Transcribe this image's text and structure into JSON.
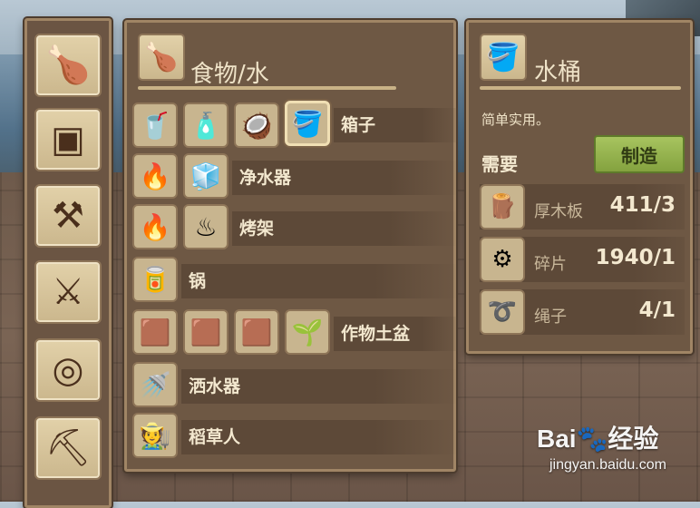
{
  "category_sidebar": {
    "buttons": [
      {
        "name": "food-water",
        "icon": "drumstick-drop-icon",
        "glyph": "🍗"
      },
      {
        "name": "storage",
        "icon": "crate-icon",
        "glyph": "▣"
      },
      {
        "name": "tools",
        "icon": "hammer-axe-icon",
        "glyph": "⚒"
      },
      {
        "name": "weapons",
        "icon": "crossed-swords-icon",
        "glyph": "⚔"
      },
      {
        "name": "equipment",
        "icon": "snorkel-mask-icon",
        "glyph": "◎"
      },
      {
        "name": "other",
        "icon": "drill-icon",
        "glyph": "⛏"
      }
    ]
  },
  "list_panel": {
    "title": "食物/水",
    "title_icon": "drumstick-icon",
    "rows": [
      {
        "label": "箱子",
        "items": [
          {
            "name": "cup",
            "glyph": "🥤"
          },
          {
            "name": "plastic-bottle",
            "glyph": "🧴"
          },
          {
            "name": "coconut-bowl",
            "glyph": "🥥"
          },
          {
            "name": "bucket",
            "glyph": "🪣",
            "selected": true
          }
        ]
      },
      {
        "label": "净水器",
        "items": [
          {
            "name": "simple-purifier",
            "glyph": "🔥"
          },
          {
            "name": "advanced-purifier",
            "glyph": "🧊"
          }
        ]
      },
      {
        "label": "烤架",
        "items": [
          {
            "name": "simple-grill",
            "glyph": "🔥"
          },
          {
            "name": "advanced-grill",
            "glyph": "♨"
          }
        ]
      },
      {
        "label": "锅",
        "items": [
          {
            "name": "cooking-pot",
            "glyph": "🥫"
          }
        ]
      },
      {
        "label": "作物土盆",
        "items": [
          {
            "name": "small-plot",
            "glyph": "🟫"
          },
          {
            "name": "medium-plot",
            "glyph": "🟫"
          },
          {
            "name": "large-plot",
            "glyph": "🟫"
          },
          {
            "name": "grass-plot",
            "glyph": "🌱"
          }
        ]
      },
      {
        "label": "洒水器",
        "items": [
          {
            "name": "sprinkler",
            "glyph": "🚿"
          }
        ]
      },
      {
        "label": "稻草人",
        "items": [
          {
            "name": "scarecrow",
            "glyph": "🧑‍🌾"
          }
        ]
      }
    ]
  },
  "detail_panel": {
    "title": "水桶",
    "title_icon": "bucket-icon",
    "description": "简单实用。",
    "requires_label": "需要",
    "craft_button": "制造",
    "requirements": [
      {
        "name": "厚木板",
        "count": "411/3",
        "icon": "plank-icon",
        "glyph": "🪵"
      },
      {
        "name": "碎片",
        "count": "1940/1",
        "icon": "scrap-icon",
        "glyph": "⚙"
      },
      {
        "name": "绳子",
        "count": "4/1",
        "icon": "rope-icon",
        "glyph": "➰"
      }
    ]
  },
  "watermark": {
    "main": "Bai🐾经验",
    "sub": "jingyan.baidu.com"
  }
}
